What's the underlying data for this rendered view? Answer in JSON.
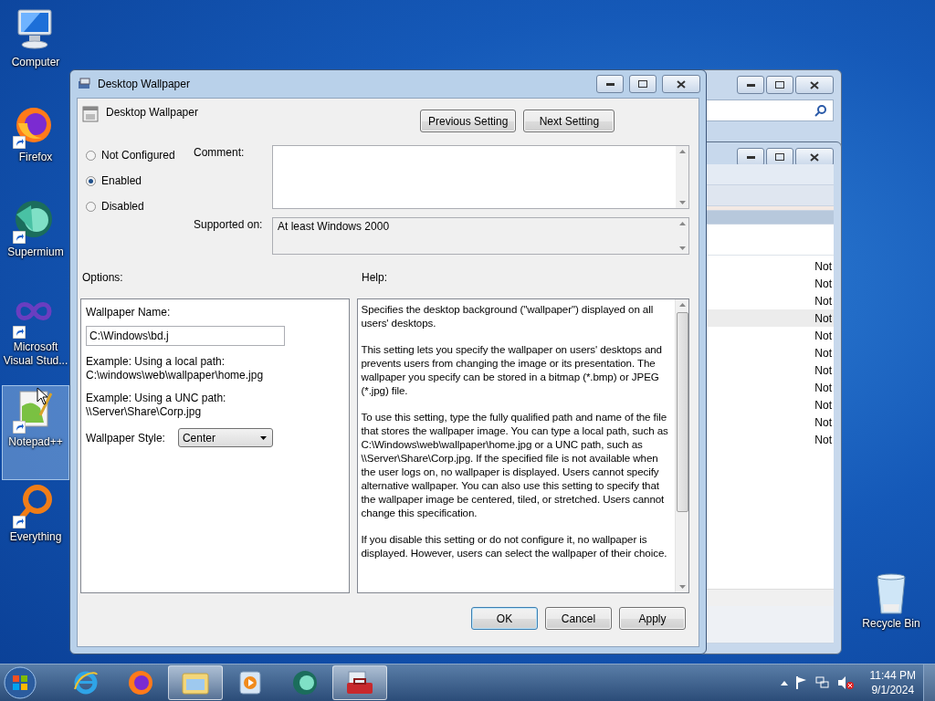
{
  "desktop_icons": [
    {
      "label": "Computer",
      "shortcut": false,
      "selected": false,
      "kind": "computer"
    },
    {
      "label": "Firefox",
      "shortcut": true,
      "selected": false,
      "kind": "firefox"
    },
    {
      "label": "Supermium",
      "shortcut": true,
      "selected": false,
      "kind": "supermium"
    },
    {
      "label": "Microsoft Visual Stud...",
      "shortcut": true,
      "selected": false,
      "kind": "visualstudio"
    },
    {
      "label": "Notepad++",
      "shortcut": true,
      "selected": true,
      "kind": "notepad"
    },
    {
      "label": "Everything",
      "shortcut": true,
      "selected": false,
      "kind": "everything"
    }
  ],
  "recycle_bin": {
    "label": "Recycle Bin"
  },
  "background_window": {
    "rows": [
      {
        "column_3": "Not",
        "selected": false
      },
      {
        "column_3": "Not",
        "selected": false
      },
      {
        "column_3": "Not",
        "selected": false
      },
      {
        "column_3": "Not",
        "selected": true
      },
      {
        "column_3": "Not",
        "selected": false
      },
      {
        "column_3": "Not",
        "selected": false
      },
      {
        "column_3": "Not",
        "selected": false
      },
      {
        "column_3": "Not",
        "selected": false
      },
      {
        "column_3": "Not",
        "selected": false
      },
      {
        "column_3": "Not",
        "selected": false
      },
      {
        "column_3": "Not",
        "selected": false
      }
    ]
  },
  "dialog": {
    "title": "Desktop Wallpaper",
    "setting_name": "Desktop Wallpaper",
    "nav_buttons": [
      "Previous Setting",
      "Next Setting"
    ],
    "states": [
      {
        "label": "Not Configured",
        "selected": false
      },
      {
        "label": "Enabled",
        "selected": true
      },
      {
        "label": "Disabled",
        "selected": false
      }
    ],
    "comment_label": "Comment:",
    "supported_label": "Supported on:",
    "supported_value": "At least Windows 2000",
    "options_label": "Options:",
    "help_label": "Help:",
    "options": {
      "name_label": "Wallpaper Name:",
      "name_value": "C:\\Windows\\bd.j",
      "examples": [
        {
          "caption": "Example: Using a local path:",
          "path": "C:\\windows\\web\\wallpaper\\home.jpg"
        },
        {
          "caption": "Example: Using a UNC path:",
          "path": "\\\\Server\\Share\\Corp.jpg"
        }
      ],
      "style_label": "Wallpaper Style:",
      "style_value": "Center"
    },
    "help": [
      "Specifies the desktop background (\"wallpaper\") displayed on all users' desktops.",
      "This setting lets you specify the wallpaper on users' desktops and prevents users from changing the image or its presentation. The wallpaper you specify can be stored in a bitmap (*.bmp) or JPEG (*.jpg) file.",
      "To use this setting, type the fully qualified path and name of the file that stores the wallpaper image. You can type a local path, such as C:\\Windows\\web\\wallpaper\\home.jpg or a UNC path, such as \\\\Server\\Share\\Corp.jpg. If the specified file is not available when the user logs on, no wallpaper is displayed. Users cannot specify alternative wallpaper. You can also use this setting to specify that the wallpaper image be centered, tiled, or stretched. Users cannot change this specification.",
      "If you disable this setting or do not configure it, no wallpaper is displayed. However, users can select the wallpaper of their choice."
    ],
    "buttons": [
      {
        "label": "OK",
        "default": true
      },
      {
        "label": "Cancel",
        "default": false
      },
      {
        "label": "Apply",
        "default": false
      }
    ]
  },
  "taskbar": {
    "items": [
      {
        "kind": "ie",
        "active": false
      },
      {
        "kind": "firefox",
        "active": false
      },
      {
        "kind": "explorer",
        "active": true
      },
      {
        "kind": "media",
        "active": false
      },
      {
        "kind": "supermium",
        "active": false
      },
      {
        "kind": "toolbox",
        "active": true
      }
    ],
    "time": "11:44 PM",
    "date": "9/1/2024"
  }
}
